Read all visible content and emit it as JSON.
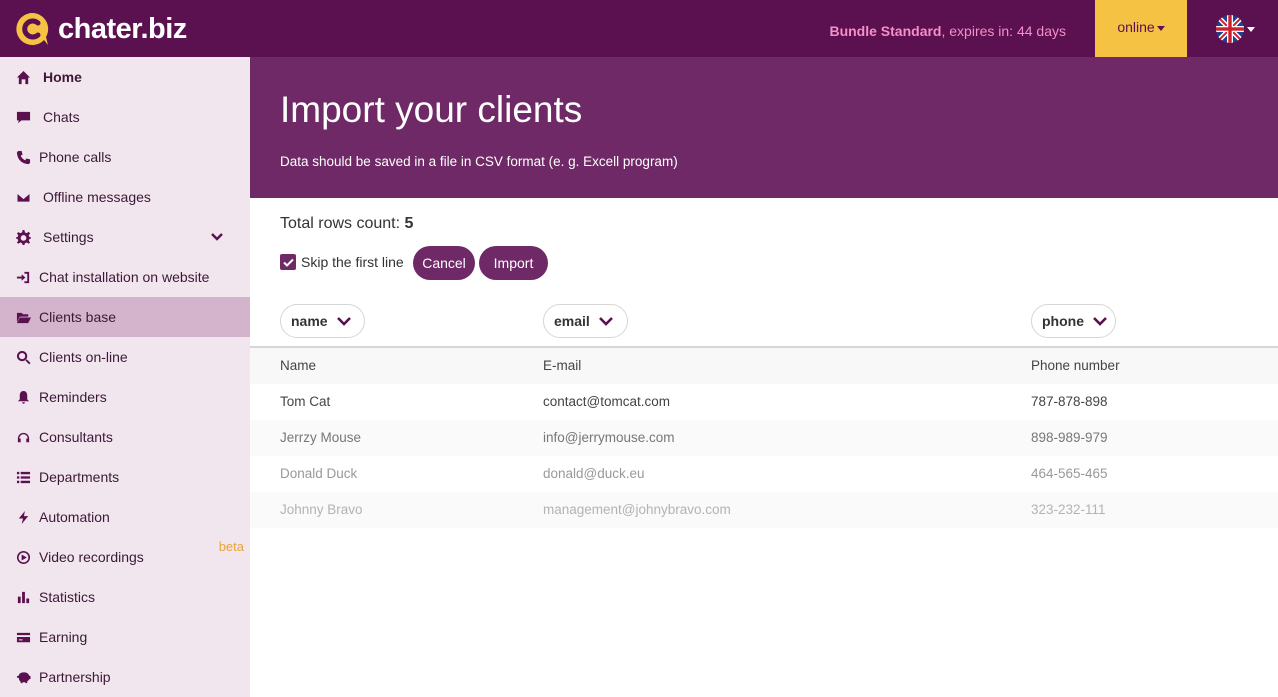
{
  "brand": {
    "name": "chater.biz"
  },
  "topbar": {
    "bundle_name": "Bundle Standard",
    "bundle_expiry": ", expires in: 44 days",
    "status_label": "online",
    "language": "en-gb-flag-icon"
  },
  "sidebar": {
    "items": [
      {
        "label": "Home",
        "icon": "home-icon"
      },
      {
        "label": "Chats",
        "icon": "chat-icon"
      },
      {
        "label": "Phone calls",
        "icon": "phone-icon"
      },
      {
        "label": "Offline messages",
        "icon": "envelope-icon"
      },
      {
        "label": "Settings",
        "icon": "gear-icon"
      },
      {
        "label": "Chat installation on website",
        "icon": "sign-in-icon"
      },
      {
        "label": "Clients base",
        "icon": "folder-open-icon",
        "active": true
      },
      {
        "label": "Clients on-line",
        "icon": "search-icon"
      },
      {
        "label": "Reminders",
        "icon": "bell-icon"
      },
      {
        "label": "Consultants",
        "icon": "headphones-icon"
      },
      {
        "label": "Departments",
        "icon": "list-icon"
      },
      {
        "label": "Automation",
        "icon": "bolt-icon"
      },
      {
        "label": "Video recordings",
        "icon": "play-circle-icon",
        "badge": "beta"
      },
      {
        "label": "Statistics",
        "icon": "bar-chart-icon"
      },
      {
        "label": "Earning",
        "icon": "credit-card-icon"
      },
      {
        "label": "Partnership",
        "icon": "piggy-bank-icon"
      }
    ]
  },
  "hero": {
    "title": "Import your clients",
    "subtitle": "Data should be saved in a file in CSV format (e. g. Excell program)"
  },
  "import": {
    "rows_label": "Total rows count: ",
    "rows_count": "5",
    "skip_first_line_label": "Skip the first line",
    "skip_first_line_checked": true,
    "cancel_label": "Cancel",
    "import_label": "Import",
    "column_mappings": [
      "name",
      "email",
      "phone"
    ]
  },
  "table": {
    "headers": [
      "Name",
      "E-mail",
      "Phone number"
    ],
    "rows": [
      [
        "Tom Cat",
        "contact@tomcat.com",
        "787-878-898"
      ],
      [
        "Jerrzy Mouse",
        "info@jerrymouse.com",
        "898-989-979"
      ],
      [
        "Donald Duck",
        "donald@duck.eu",
        "464-565-465"
      ],
      [
        "Johnny Bravo",
        "management@johnybravo.com",
        "323-232-111"
      ]
    ]
  },
  "colors": {
    "topbar": "#5b1150",
    "hero": "#6e2966",
    "status": "#f6c244",
    "sidebar": "#f1e6ee",
    "sidebar_active": "#d4b3cd",
    "bundle_text": "#f48fc8"
  }
}
